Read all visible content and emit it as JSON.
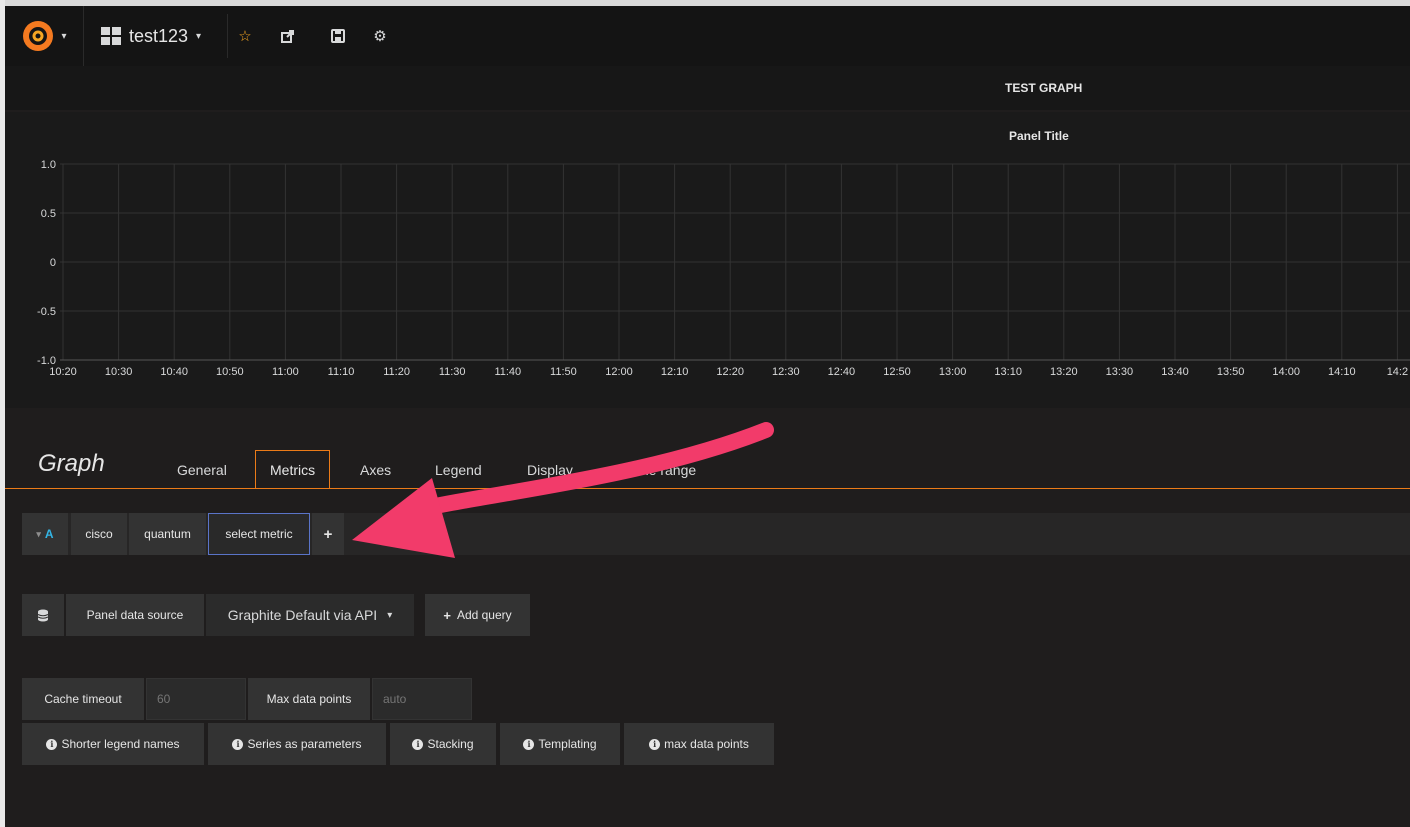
{
  "navbar": {
    "dashboard_name": "test123",
    "icons": [
      "grafana-logo",
      "dashboard-grid-icon",
      "star-icon",
      "share-icon",
      "save-icon",
      "gear-icon"
    ]
  },
  "dashboard": {
    "row_title": "TEST GRAPH"
  },
  "panel": {
    "title": "Panel Title"
  },
  "chart_data": {
    "type": "line",
    "title": "Panel Title",
    "x": [
      "10:20",
      "10:30",
      "10:40",
      "10:50",
      "11:00",
      "11:10",
      "11:20",
      "11:30",
      "11:40",
      "11:50",
      "12:00",
      "12:10",
      "12:20",
      "12:30",
      "12:40",
      "12:50",
      "13:00",
      "13:10",
      "13:20",
      "13:30",
      "13:40",
      "13:50",
      "14:00",
      "14:10",
      "14:2"
    ],
    "y_ticks": [
      "1.0",
      "0.5",
      "0",
      "-0.5",
      "-1.0"
    ],
    "ylim": [
      -1.0,
      1.0
    ],
    "series": [],
    "grid": true
  },
  "editor": {
    "title": "Graph",
    "tabs": [
      {
        "label": "General"
      },
      {
        "label": "Metrics"
      },
      {
        "label": "Axes"
      },
      {
        "label": "Legend"
      },
      {
        "label": "Display"
      },
      {
        "label": "me range"
      }
    ]
  },
  "query": {
    "ref_id": "A",
    "segments": [
      "cisco",
      "quantum"
    ],
    "select_metric": "select metric",
    "add_segment": "+"
  },
  "datasource": {
    "label": "Panel data source",
    "selected": "Graphite Default via API",
    "add_query": "Add query"
  },
  "options": {
    "cache_timeout_label": "Cache timeout",
    "cache_timeout_placeholder": "60",
    "max_data_points_label": "Max data points",
    "max_data_points_placeholder": "auto"
  },
  "help_buttons": [
    "Shorter legend names",
    "Series as parameters",
    "Stacking",
    "Templating",
    "max data points"
  ],
  "colors": {
    "accent_tab": "#eb7b18",
    "annotation_arrow": "#f23b6a",
    "ref_id": "#33b5e5",
    "focus_border": "#5a74c8"
  }
}
